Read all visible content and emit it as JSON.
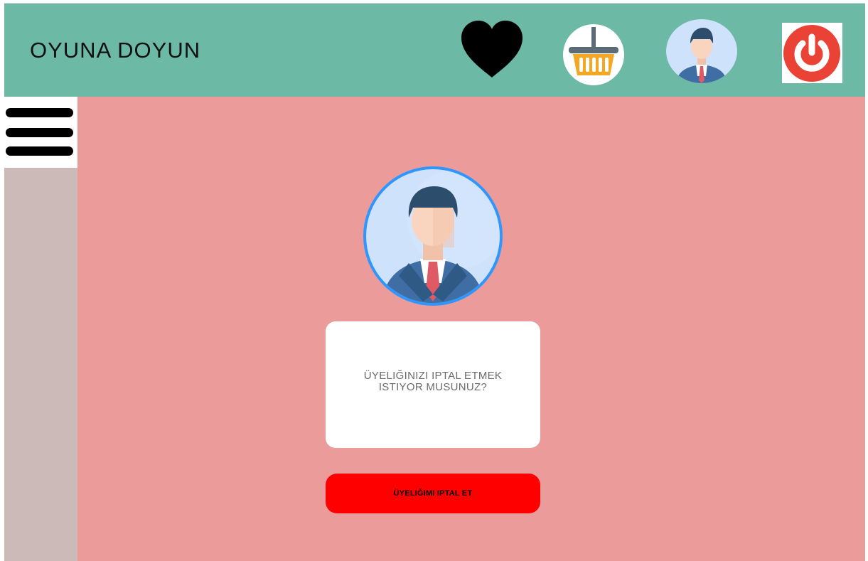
{
  "header": {
    "title": "OYUNA DOYUN",
    "icons": {
      "favorites": "heart-icon",
      "cart": "basket-icon",
      "profile": "user-avatar-icon",
      "logout": "power-icon"
    }
  },
  "sidebar": {
    "menu_icon": "hamburger-menu-icon"
  },
  "main": {
    "avatar_icon": "user-avatar-icon",
    "dialog": {
      "message": "ÜYELIĞINIZI IPTAL ETMEK ISTIYOR MUSUNUZ?"
    },
    "cancel_button": {
      "label": "ÜYELIĞIMI IPTAL ET"
    }
  },
  "colors": {
    "header_bg": "#6cb9a6",
    "sidebar_bg": "#cbbab8",
    "content_bg": "#ec9b9b",
    "cancel_button": "#ff0000",
    "power_red": "#ea4335"
  }
}
